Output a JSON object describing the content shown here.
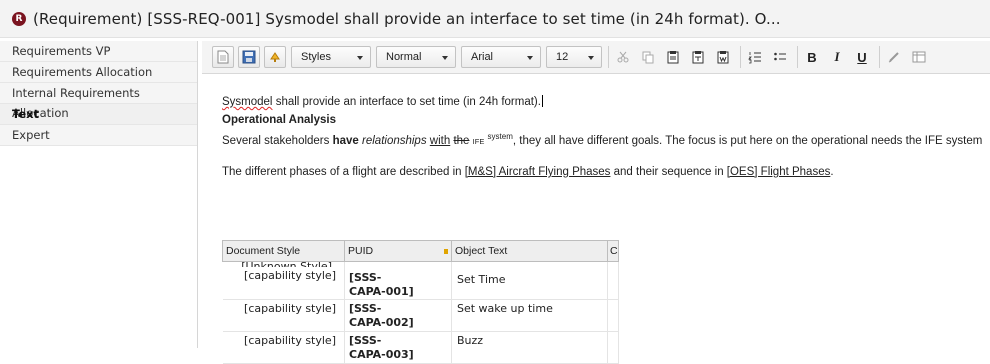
{
  "title": {
    "icon_glyph": "R",
    "text": "(Requirement)  [SSS-REQ-001] Sysmodel shall provide an interface to set time (in 24h format). O..."
  },
  "sidebar": {
    "items": [
      {
        "label": "Requirements VP"
      },
      {
        "label": "Requirements Allocation"
      },
      {
        "label": "Internal Requirements Allocation"
      },
      {
        "label": "Text"
      },
      {
        "label": "Expert"
      }
    ]
  },
  "toolbar": {
    "styles_value": "Styles",
    "format_value": "Normal",
    "font_value": "Arial",
    "size_value": "12",
    "bold_label": "B",
    "italic_label": "I",
    "underline_label": "U",
    "icons": [
      "new-document-icon",
      "save-icon",
      "refresh-icon",
      "cut-icon",
      "copy-icon",
      "paste-icon",
      "paste-text-icon",
      "paste-word-icon",
      "numbered-list-icon",
      "bulleted-list-icon",
      "link-icon",
      "table-icon"
    ]
  },
  "document": {
    "line1": {
      "spell_word": "Sysmodel",
      "rest": " shall provide an interface to set time (in 24h format)."
    },
    "heading": "Operational Analysis",
    "para1": {
      "t1": "Several stakeholders ",
      "bold": "have",
      "t2": " ",
      "italic": "relationships",
      "t3": " ",
      "underlined": "with",
      "t4": " ",
      "struck": "the",
      "t5": " ",
      "small": "IFE",
      "t6": " ",
      "sup": "system",
      "t7": ", they all have different goals. The focus is put here on the operational needs the IFE system"
    },
    "para2": {
      "t1": "The different phases of a flight are described in ",
      "link1": "[M&S] Aircraft Flying Phases",
      "t2": " and their sequence in ",
      "link2": "[OES] Flight Phases",
      "t3": "."
    }
  },
  "table": {
    "headers": [
      "Document Style",
      "PUID",
      "Object Text",
      "C"
    ],
    "unknown_style": "[Unknown Style]",
    "rows": [
      {
        "style": "[capability style]",
        "puid_a": "[SSS-",
        "puid_b": "CAPA-001]",
        "text": "Set Time"
      },
      {
        "style": "[capability style]",
        "puid_a": "[SSS-",
        "puid_b": "CAPA-002]",
        "text": "Set wake up time"
      },
      {
        "style": "[capability style]",
        "puid_a": "[SSS-",
        "puid_b": "CAPA-003]",
        "text": "Buzz"
      }
    ]
  },
  "colors": {
    "title_icon": "#7b1420",
    "spell_underline": "#dd2222",
    "sort_marker": "#e0a400"
  }
}
